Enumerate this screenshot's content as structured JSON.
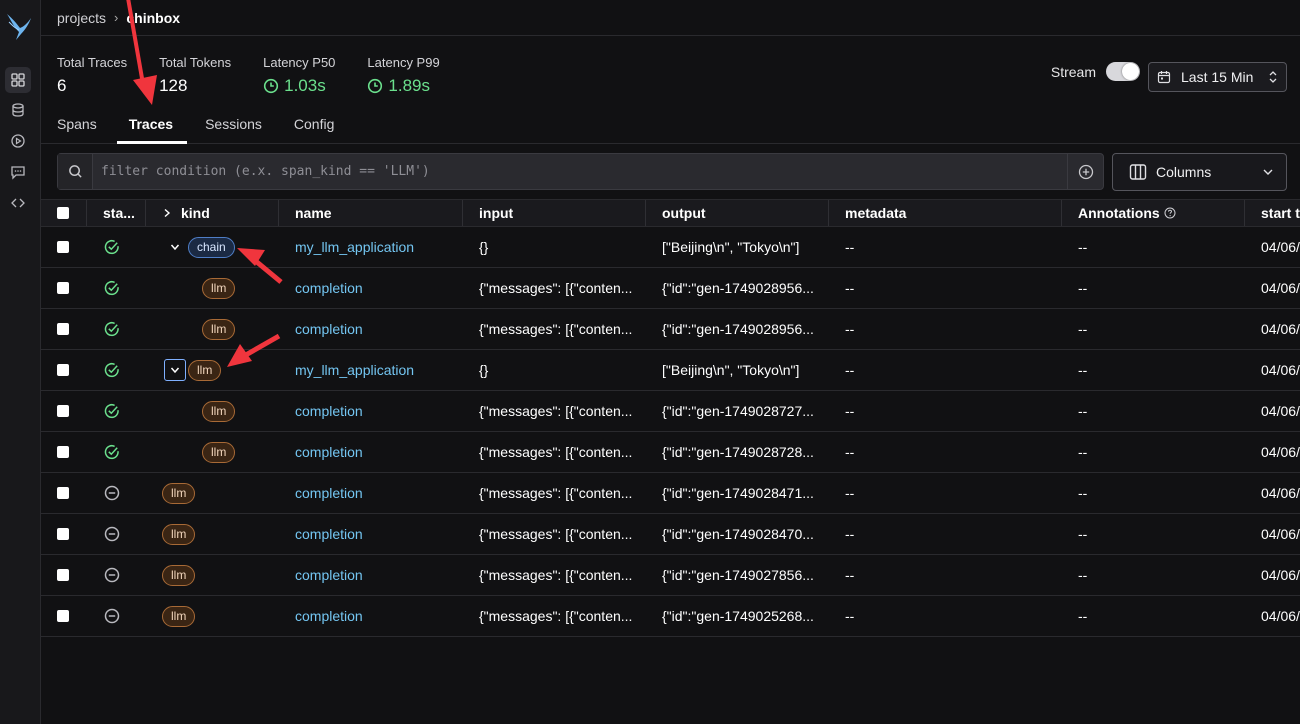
{
  "breadcrumb": {
    "root": "projects",
    "current": "chinbox"
  },
  "stats": [
    {
      "label": "Total Traces",
      "value": "6",
      "latency": false
    },
    {
      "label": "Total Tokens",
      "value": "128",
      "latency": false
    },
    {
      "label": "Latency P50",
      "value": "1.03s",
      "latency": true
    },
    {
      "label": "Latency P99",
      "value": "1.89s",
      "latency": true
    }
  ],
  "stream": {
    "label": "Stream",
    "enabled": true
  },
  "timerange": {
    "label": "Last 15 Min"
  },
  "tabs": [
    {
      "label": "Spans",
      "active": false
    },
    {
      "label": "Traces",
      "active": true
    },
    {
      "label": "Sessions",
      "active": false
    },
    {
      "label": "Config",
      "active": false
    }
  ],
  "filter": {
    "placeholder": "filter condition (e.x. span_kind == 'LLM')",
    "value": ""
  },
  "columns_button": {
    "label": "Columns"
  },
  "table": {
    "headers": [
      "sta...",
      "kind",
      "name",
      "input",
      "output",
      "metadata",
      "Annotations",
      "start ti"
    ],
    "rows": [
      {
        "status": "ok",
        "expand": "down",
        "focused": false,
        "indent": 0,
        "kind": "chain",
        "name": "my_llm_application",
        "input": "{}",
        "output": "[\"Beijing\\n\", \"Tokyo\\n\"]",
        "metadata": "--",
        "annotations": "--",
        "start": "04/06/"
      },
      {
        "status": "ok",
        "expand": "none",
        "focused": false,
        "indent": 1,
        "kind": "llm",
        "name": "completion",
        "input": "{\"messages\": [{\"conten...",
        "output": "{\"id\":\"gen-1749028956...",
        "metadata": "--",
        "annotations": "--",
        "start": "04/06/"
      },
      {
        "status": "ok",
        "expand": "none",
        "focused": false,
        "indent": 1,
        "kind": "llm",
        "name": "completion",
        "input": "{\"messages\": [{\"conten...",
        "output": "{\"id\":\"gen-1749028956...",
        "metadata": "--",
        "annotations": "--",
        "start": "04/06/"
      },
      {
        "status": "ok",
        "expand": "down",
        "focused": true,
        "indent": 0,
        "kind": "llm",
        "name": "my_llm_application",
        "input": "{}",
        "output": "[\"Beijing\\n\", \"Tokyo\\n\"]",
        "metadata": "--",
        "annotations": "--",
        "start": "04/06/"
      },
      {
        "status": "ok",
        "expand": "none",
        "focused": false,
        "indent": 1,
        "kind": "llm",
        "name": "completion",
        "input": "{\"messages\": [{\"conten...",
        "output": "{\"id\":\"gen-1749028727...",
        "metadata": "--",
        "annotations": "--",
        "start": "04/06/"
      },
      {
        "status": "ok",
        "expand": "none",
        "focused": false,
        "indent": 1,
        "kind": "llm",
        "name": "completion",
        "input": "{\"messages\": [{\"conten...",
        "output": "{\"id\":\"gen-1749028728...",
        "metadata": "--",
        "annotations": "--",
        "start": "04/06/"
      },
      {
        "status": "unset",
        "expand": "none",
        "focused": false,
        "indent": -1,
        "kind": "llm",
        "name": "completion",
        "input": "{\"messages\": [{\"conten...",
        "output": "{\"id\":\"gen-1749028471...",
        "metadata": "--",
        "annotations": "--",
        "start": "04/06/"
      },
      {
        "status": "unset",
        "expand": "none",
        "focused": false,
        "indent": -1,
        "kind": "llm",
        "name": "completion",
        "input": "{\"messages\": [{\"conten...",
        "output": "{\"id\":\"gen-1749028470...",
        "metadata": "--",
        "annotations": "--",
        "start": "04/06/"
      },
      {
        "status": "unset",
        "expand": "none",
        "focused": false,
        "indent": -1,
        "kind": "llm",
        "name": "completion",
        "input": "{\"messages\": [{\"conten...",
        "output": "{\"id\":\"gen-1749027856...",
        "metadata": "--",
        "annotations": "--",
        "start": "04/06/"
      },
      {
        "status": "unset",
        "expand": "none",
        "focused": false,
        "indent": -1,
        "kind": "llm",
        "name": "completion",
        "input": "{\"messages\": [{\"conten...",
        "output": "{\"id\":\"gen-1749025268...",
        "metadata": "--",
        "annotations": "--",
        "start": "04/06/"
      }
    ]
  },
  "colors": {
    "accent_green": "#6be08d",
    "link_blue": "#74c6f2",
    "annotation_red": "#f0353d"
  }
}
